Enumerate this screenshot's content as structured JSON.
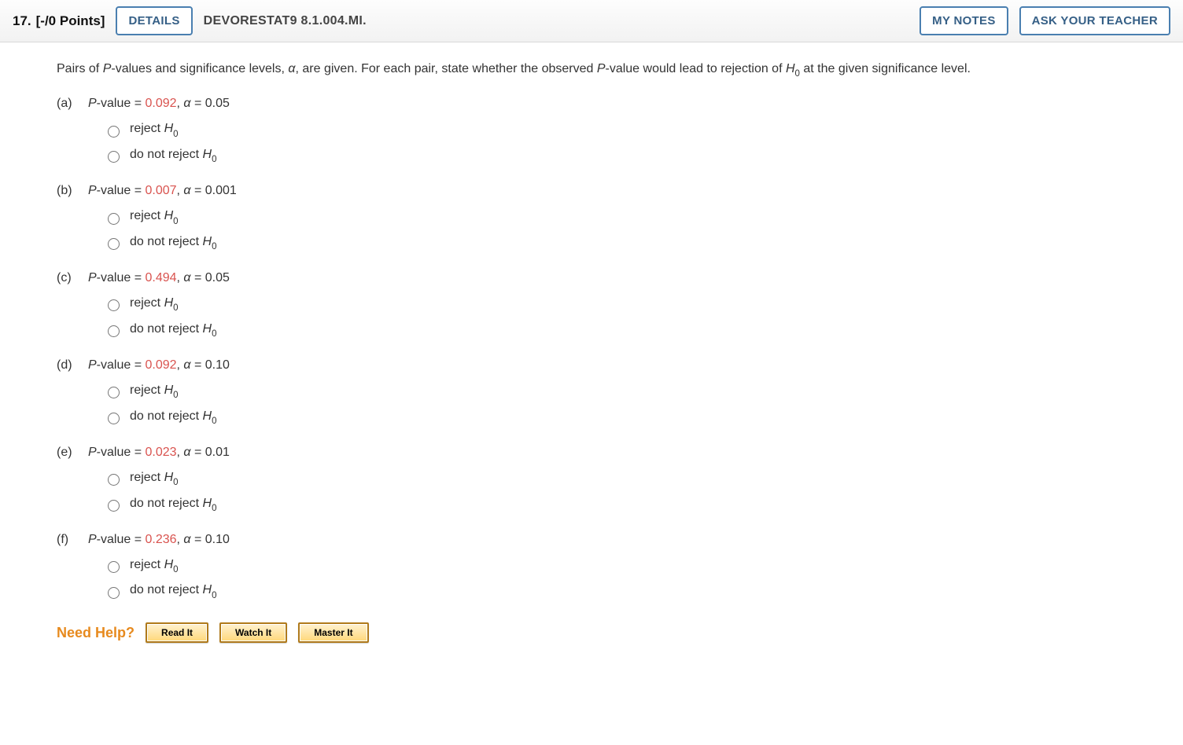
{
  "header": {
    "qnum": "17.",
    "points": "[-/0 Points]",
    "details": "DETAILS",
    "source": "DEVORESTAT9 8.1.004.MI.",
    "mynotes": "MY NOTES",
    "ask": "ASK YOUR TEACHER"
  },
  "prompt": {
    "t1": "Pairs of ",
    "t2": "P",
    "t3": "-values and significance levels, ",
    "t4": "α",
    "t5": ", are given. For each pair, state whether the observed ",
    "t6": "P",
    "t7": "-value would lead to rejection of ",
    "t8": "H",
    "t9": "0",
    "t10": " at the given significance level."
  },
  "opt_reject_pre": "reject ",
  "opt_reject_H": "H",
  "opt_reject_0": "0",
  "opt_dnr_pre": "do not reject ",
  "opt_dnr_H": "H",
  "opt_dnr_0": "0",
  "parts": [
    {
      "label": "(a)",
      "pre": "P",
      "mid": "-value = ",
      "pval": "0.092",
      "post1": ", ",
      "alpha_sym": "α",
      "post2": " = ",
      "alpha": "0.05"
    },
    {
      "label": "(b)",
      "pre": "P",
      "mid": "-value = ",
      "pval": "0.007",
      "post1": ", ",
      "alpha_sym": "α",
      "post2": " = ",
      "alpha": "0.001"
    },
    {
      "label": "(c)",
      "pre": "P",
      "mid": "-value = ",
      "pval": "0.494",
      "post1": ", ",
      "alpha_sym": "α",
      "post2": " = ",
      "alpha": "0.05"
    },
    {
      "label": "(d)",
      "pre": "P",
      "mid": "-value = ",
      "pval": "0.092",
      "post1": ", ",
      "alpha_sym": "α",
      "post2": " = ",
      "alpha": "0.10"
    },
    {
      "label": "(e)",
      "pre": "P",
      "mid": "-value = ",
      "pval": "0.023",
      "post1": ", ",
      "alpha_sym": "α",
      "post2": " = ",
      "alpha": "0.01"
    },
    {
      "label": "(f)",
      "pre": "P",
      "mid": "-value = ",
      "pval": "0.236",
      "post1": ", ",
      "alpha_sym": "α",
      "post2": " = ",
      "alpha": "0.10"
    }
  ],
  "help": {
    "label": "Need Help?",
    "read": "Read It",
    "watch": "Watch It",
    "master": "Master It"
  }
}
